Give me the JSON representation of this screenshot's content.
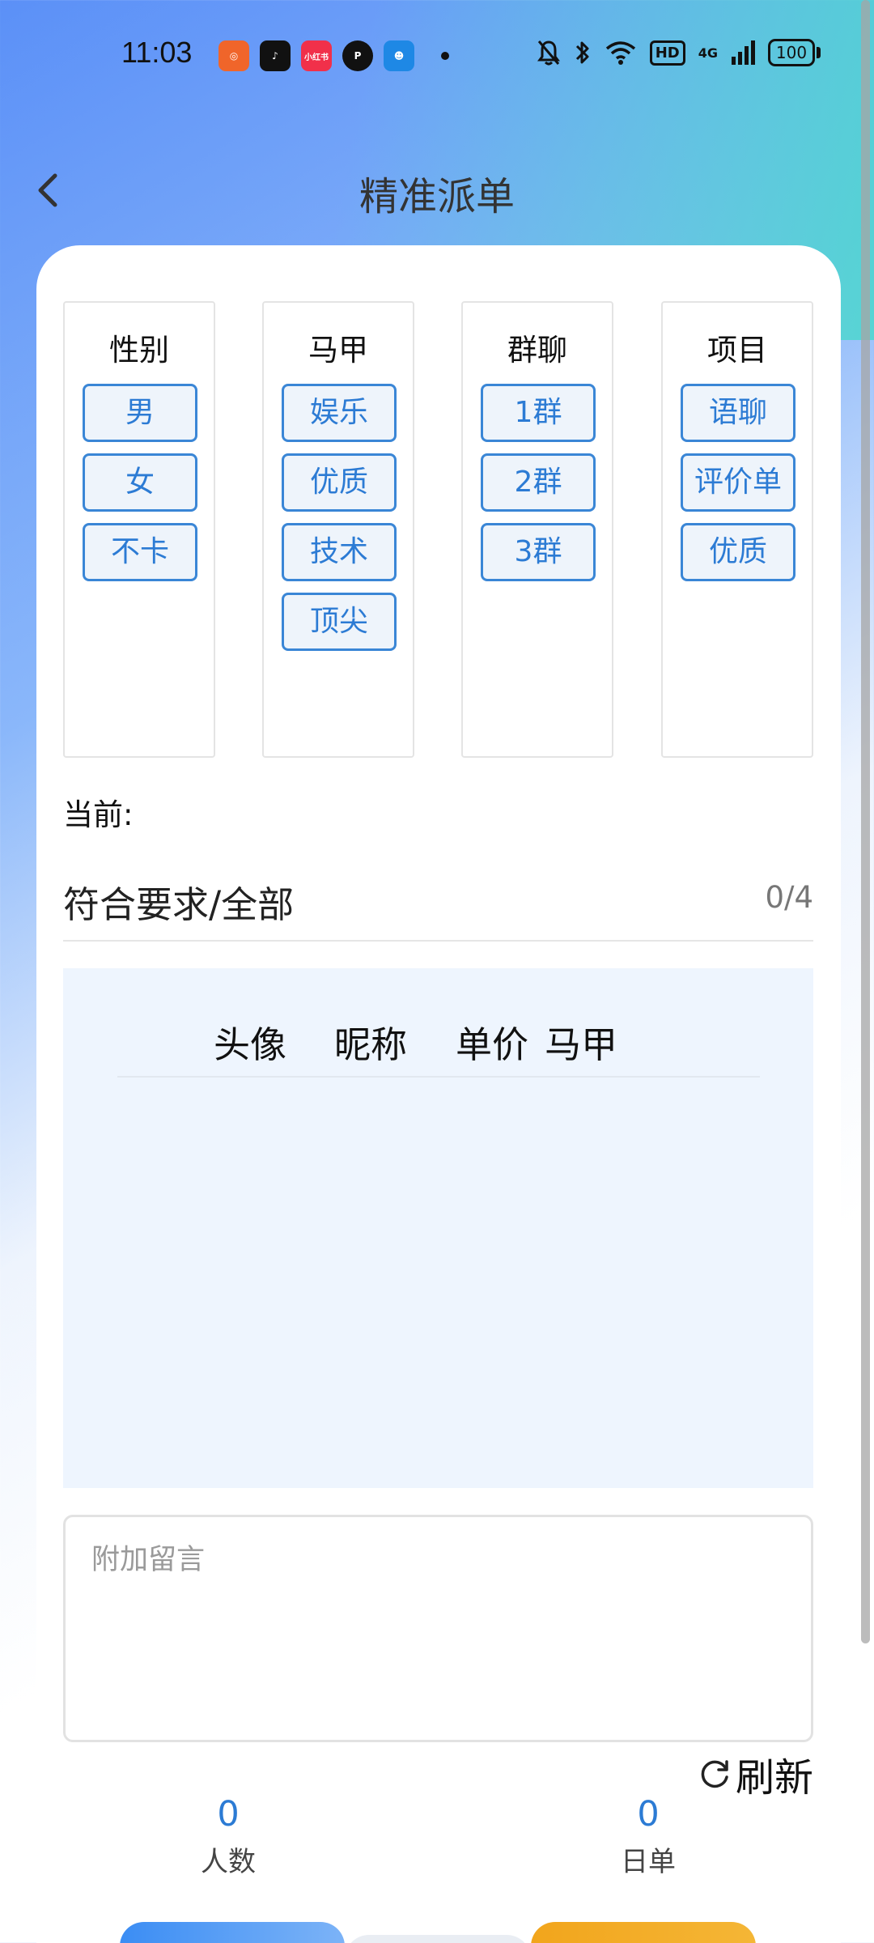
{
  "status_bar": {
    "time": "11:03",
    "apps": [
      {
        "name": "kuaishou-icon",
        "color": "#f0652a",
        "glyph": "◎"
      },
      {
        "name": "douyin-icon",
        "color": "#111111",
        "glyph": "♪"
      },
      {
        "name": "xiaohongshu-icon",
        "color": "#f1304a",
        "glyph": "小红书"
      },
      {
        "name": "app-p-icon",
        "color": "#111111",
        "glyph": "P"
      },
      {
        "name": "robot-app-icon",
        "color": "#1e88e5",
        "glyph": "☻"
      }
    ],
    "network": "4G",
    "hd_label": "HD",
    "battery": "100"
  },
  "header": {
    "title": "精准派单"
  },
  "filters": {
    "columns": [
      {
        "title": "性别",
        "options": [
          "男",
          "女",
          "不卡"
        ]
      },
      {
        "title": "马甲",
        "options": [
          "娱乐",
          "优质",
          "技术",
          "顶尖"
        ]
      },
      {
        "title": "群聊",
        "options": [
          "1群",
          "2群",
          "3群"
        ]
      },
      {
        "title": "项目",
        "options": [
          "语聊",
          "评价单",
          "优质"
        ]
      }
    ]
  },
  "current": {
    "label": "当前:"
  },
  "match": {
    "label": "符合要求/全部",
    "count": "0/4"
  },
  "table": {
    "headers": [
      "头像",
      "昵称",
      "单价",
      "马甲"
    ]
  },
  "message": {
    "placeholder": "附加留言",
    "value": ""
  },
  "refresh": {
    "label": "刷新"
  },
  "stats": [
    {
      "value": "0",
      "label": "人数"
    },
    {
      "value": "0",
      "label": "日单"
    }
  ],
  "colors": {
    "accent": "#2c7bd4",
    "chip_bg": "#eef4fb",
    "primary_button": "#3b8df4",
    "secondary_button": "#f2a51c"
  }
}
